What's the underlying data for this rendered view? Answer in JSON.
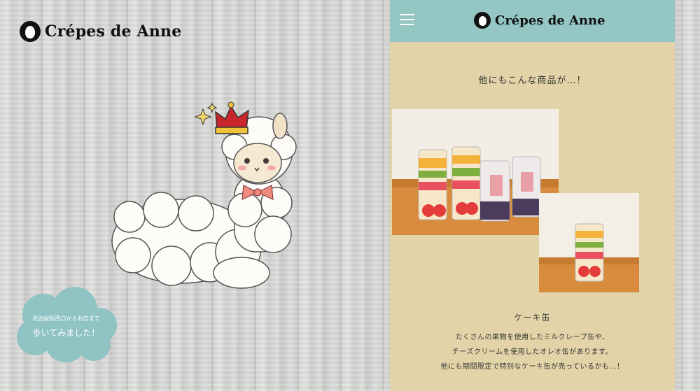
{
  "brand": {
    "name": "Crépes de Anne"
  },
  "cloud": {
    "line1": "名古屋駅西口からお店まで",
    "line2": "歩いてみました！"
  },
  "panel": {
    "brand_name": "Crépes de Anne",
    "section_title": "他にもこんな商品が…！",
    "product_title": "ケーキ缶",
    "description": [
      "たくさんの果物を使用したミルクレープ缶や、",
      "チーズクリームを使用したオレオ缶があります。",
      "他にも期間限定で特別なケーキ缶が売っているかも…！"
    ]
  },
  "colors": {
    "header": "#94c6c4",
    "panel_bg": "#e2d4a8",
    "cloud": "#8fc3c4"
  },
  "icons": [
    "menu-icon",
    "logo-icon",
    "alpaca-illustration"
  ]
}
